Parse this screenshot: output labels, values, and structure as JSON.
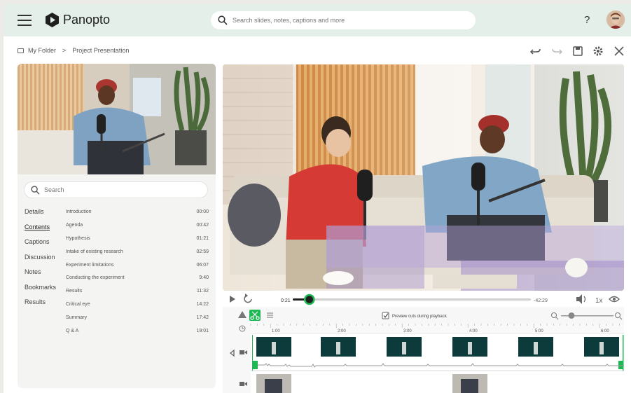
{
  "header": {
    "logo_text": "Panopto",
    "search_placeholder": "Search slides, notes, captions and more",
    "help": "?"
  },
  "breadcrumb": {
    "folder": "My Folder",
    "separator": ">",
    "project": "Project Presentation"
  },
  "sidebar": {
    "search_placeholder": "Search",
    "nav": [
      {
        "label": "Details"
      },
      {
        "label": "Contents"
      },
      {
        "label": "Captions"
      },
      {
        "label": "Discussion"
      },
      {
        "label": "Notes"
      },
      {
        "label": "Bookmarks"
      },
      {
        "label": "Results"
      }
    ],
    "chapters": [
      {
        "title": "Introduction",
        "time": "00:00"
      },
      {
        "title": "Agenda",
        "time": "00:42"
      },
      {
        "title": "Hypothesis",
        "time": "01:21"
      },
      {
        "title": "Intake of existing research",
        "time": "02:59"
      },
      {
        "title": "Experiment limitations",
        "time": "06:07"
      },
      {
        "title": "Conducting the experiment",
        "time": "9:40"
      },
      {
        "title": "Results",
        "time": "11:32"
      },
      {
        "title": "Critical eye",
        "time": "14:22"
      },
      {
        "title": "Summary",
        "time": "17:42"
      },
      {
        "title": "Q & A",
        "time": "19:01"
      }
    ]
  },
  "player": {
    "current": "0:21",
    "remaining": "-42:29",
    "speed": "1x",
    "progress": 0.07
  },
  "editor": {
    "preview_label": "Preview cuts during playback",
    "ruler": [
      "1:00",
      "2:00",
      "3:00",
      "4:00",
      "5:00",
      "6:00"
    ],
    "zoom": 0.2
  },
  "colors": {
    "accent": "#1db954",
    "topbar": "#e3efe8"
  }
}
